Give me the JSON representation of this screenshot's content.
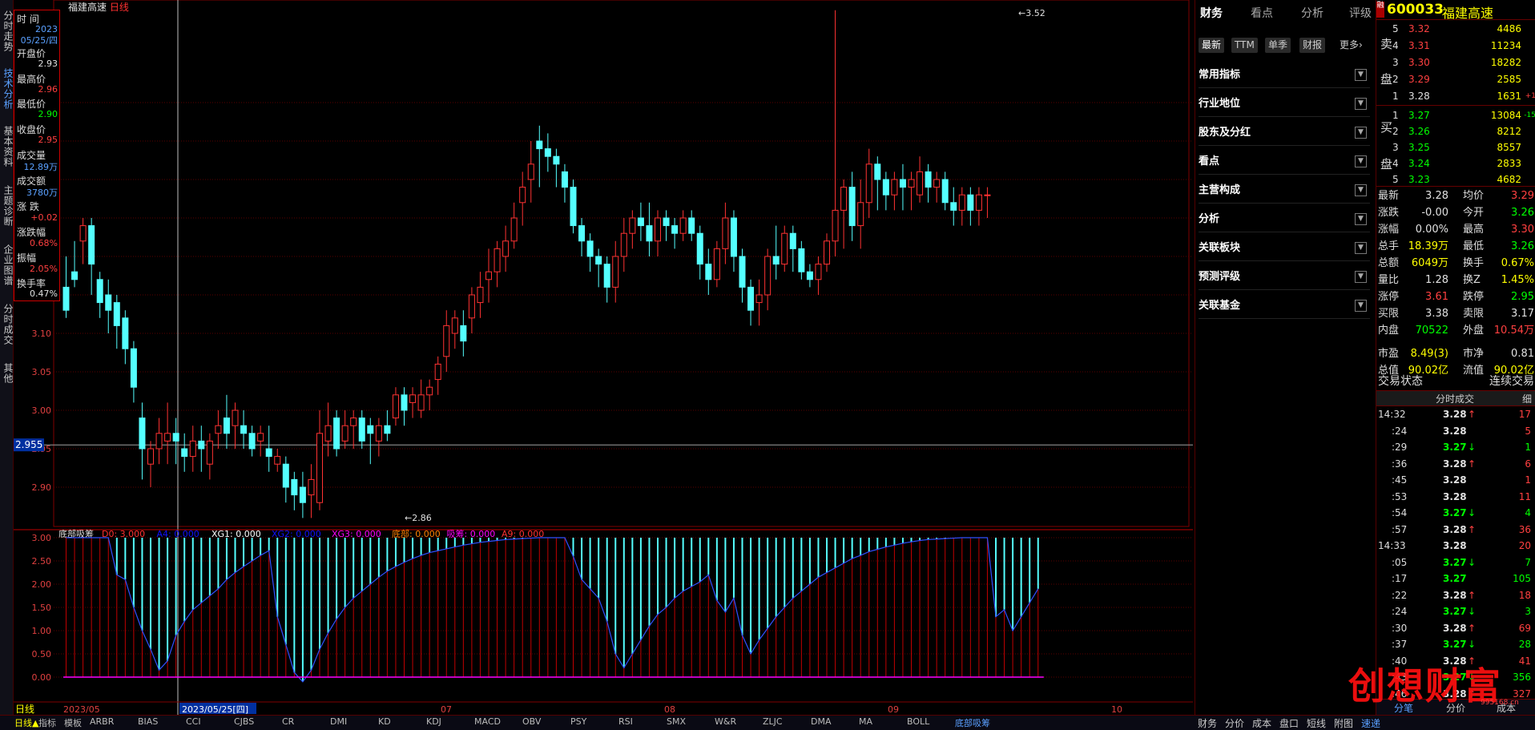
{
  "stock": {
    "code": "600033",
    "name": "福建高速",
    "period": "日线",
    "title": "福建高速"
  },
  "left_tabs": [
    "分时走势",
    "技术分析",
    "基本资料",
    "主题诊断",
    "企业图谱",
    "分时成交",
    "其他"
  ],
  "info_box": [
    {
      "label": "时 间",
      "value": "2023"
    },
    {
      "label": "",
      "value": "05/25/四"
    },
    {
      "label": "开盘价",
      "value": "2.93"
    },
    {
      "label": "最高价",
      "value": "2.96"
    },
    {
      "label": "最低价",
      "value": "2.90"
    },
    {
      "label": "收盘价",
      "value": "2.95"
    },
    {
      "label": "成交量",
      "value": "12.89万"
    },
    {
      "label": "成交额",
      "value": "3780万"
    },
    {
      "label": "涨 跌",
      "value": "+0.02"
    },
    {
      "label": "涨跌幅",
      "value": "0.68%"
    },
    {
      "label": "振幅",
      "value": "2.05%"
    },
    {
      "label": "换手率",
      "value": "0.47%"
    }
  ],
  "chart_data": {
    "type": "candlestick",
    "price_axis": [
      "3.10",
      "3.05",
      "3.00",
      "2.95",
      "2.90"
    ],
    "cursor_price": "2.955",
    "high_label": "3.52",
    "low_label": "2.86",
    "indicator_axis": [
      "3.00",
      "2.50",
      "2.00",
      "1.50",
      "1.00",
      "0.50",
      "0.00"
    ],
    "indicator_title": "底部吸筹",
    "indicator_legend": [
      {
        "text": "D0: 3.000",
        "color": "#ff3030"
      },
      {
        "text": "A4: 0.000",
        "color": "#1010ff"
      },
      {
        "text": "XG1: 0.000",
        "color": "#ffffff"
      },
      {
        "text": "XG2: 0.000",
        "color": "#1010ff"
      },
      {
        "text": "XG3: 0.000",
        "color": "#ff00ff"
      },
      {
        "text": "底部: 0.000",
        "color": "#ff8000"
      },
      {
        "text": "吸筹: 0.000",
        "color": "#ff00ff"
      },
      {
        "text": "A9: 0.000",
        "color": "#ff3030"
      }
    ],
    "date_axis": [
      "2023/05",
      "2023/05/25[四]",
      "07",
      "08",
      "09",
      "10"
    ]
  },
  "fin": {
    "tabs": [
      "财务",
      "看点",
      "分析",
      "评级"
    ],
    "subtabs": [
      "最新",
      "TTM",
      "单季",
      "财报",
      "更多"
    ],
    "sections": [
      "常用指标",
      "行业地位",
      "股东及分红",
      "看点",
      "主营构成",
      "分析",
      "关联板块",
      "预测评级",
      "关联基金"
    ]
  },
  "quote": {
    "sell_label": [
      "卖",
      "盘"
    ],
    "buy_label": [
      "买",
      "盘"
    ],
    "asks": [
      {
        "level": "5",
        "price": "3.32",
        "vol": "4486",
        "chg": ""
      },
      {
        "level": "4",
        "price": "3.31",
        "vol": "11234",
        "chg": ""
      },
      {
        "level": "3",
        "price": "3.30",
        "vol": "18282",
        "chg": ""
      },
      {
        "level": "2",
        "price": "3.29",
        "vol": "2585",
        "chg": ""
      },
      {
        "level": "1",
        "price": "3.28",
        "vol": "1631",
        "chg": "+1"
      }
    ],
    "bids": [
      {
        "level": "1",
        "price": "3.27",
        "vol": "13084",
        "chg": "-15"
      },
      {
        "level": "2",
        "price": "3.26",
        "vol": "8212",
        "chg": ""
      },
      {
        "level": "3",
        "price": "3.25",
        "vol": "8557",
        "chg": ""
      },
      {
        "level": "4",
        "price": "3.24",
        "vol": "2833",
        "chg": ""
      },
      {
        "level": "5",
        "price": "3.23",
        "vol": "4682",
        "chg": ""
      }
    ],
    "stats": [
      {
        "l1": "最新",
        "v1": "3.28",
        "c1": "#e0e0e0",
        "l2": "均价",
        "v2": "3.29",
        "c2": "#ff4040"
      },
      {
        "l1": "涨跌",
        "v1": "-0.00",
        "c1": "#e0e0e0",
        "l2": "今开",
        "v2": "3.26",
        "c2": "#00ff00"
      },
      {
        "l1": "涨幅",
        "v1": "0.00%",
        "c1": "#e0e0e0",
        "l2": "最高",
        "v2": "3.30",
        "c2": "#ff4040"
      },
      {
        "l1": "总手",
        "v1": "18.39万",
        "c1": "#ffff00",
        "l2": "最低",
        "v2": "3.26",
        "c2": "#00ff00"
      },
      {
        "l1": "总额",
        "v1": "6049万",
        "c1": "#ffff00",
        "l2": "换手",
        "v2": "0.67%",
        "c2": "#ffff00"
      },
      {
        "l1": "量比",
        "v1": "1.28",
        "c1": "#e0e0e0",
        "l2": "换Z",
        "v2": "1.45%",
        "c2": "#ffff00"
      },
      {
        "l1": "涨停",
        "v1": "3.61",
        "c1": "#ff4040",
        "l2": "跌停",
        "v2": "2.95",
        "c2": "#00ff00"
      },
      {
        "l1": "买限",
        "v1": "3.38",
        "c1": "#e0e0e0",
        "l2": "卖限",
        "v2": "3.17",
        "c2": "#e0e0e0"
      },
      {
        "l1": "内盘",
        "v1": "70522",
        "c1": "#00ff00",
        "l2": "外盘",
        "v2": "10.54万",
        "c2": "#ff4040"
      },
      {
        "l1": "市盈",
        "v1": "8.49(3)",
        "c1": "#ffff00",
        "l2": "市净",
        "v2": "0.81",
        "c2": "#e0e0e0"
      },
      {
        "l1": "总值",
        "v1": "90.02亿",
        "c1": "#ffff00",
        "l2": "流值",
        "v2": "90.02亿",
        "c2": "#ffff00"
      }
    ],
    "trade_status_label": "交易状态",
    "trade_status_value": "连续交易",
    "ticks_title": "分时成交",
    "ticks_detail": "细",
    "ticks": [
      {
        "t": "14:32",
        "p": "3.28",
        "pc": "#e0e0e0",
        "a": "↑",
        "ac": "#ff4040",
        "v": "17",
        "vc": "#ff4040"
      },
      {
        "t": ":24",
        "p": "3.28",
        "pc": "#e0e0e0",
        "a": "",
        "ac": "",
        "v": "5",
        "vc": "#ff4040"
      },
      {
        "t": ":29",
        "p": "3.27",
        "pc": "#00ff00",
        "a": "↓",
        "ac": "#00ff00",
        "v": "1",
        "vc": "#00ff00"
      },
      {
        "t": ":36",
        "p": "3.28",
        "pc": "#e0e0e0",
        "a": "↑",
        "ac": "#ff4040",
        "v": "6",
        "vc": "#ff4040"
      },
      {
        "t": ":45",
        "p": "3.28",
        "pc": "#e0e0e0",
        "a": "",
        "ac": "",
        "v": "1",
        "vc": "#ff4040"
      },
      {
        "t": ":53",
        "p": "3.28",
        "pc": "#e0e0e0",
        "a": "",
        "ac": "",
        "v": "11",
        "vc": "#ff4040"
      },
      {
        "t": ":54",
        "p": "3.27",
        "pc": "#00ff00",
        "a": "↓",
        "ac": "#00ff00",
        "v": "4",
        "vc": "#00ff00"
      },
      {
        "t": ":57",
        "p": "3.28",
        "pc": "#e0e0e0",
        "a": "↑",
        "ac": "#ff4040",
        "v": "36",
        "vc": "#ff4040"
      },
      {
        "t": "14:33",
        "p": "3.28",
        "pc": "#e0e0e0",
        "a": "",
        "ac": "",
        "v": "20",
        "vc": "#ff4040"
      },
      {
        "t": ":05",
        "p": "3.27",
        "pc": "#00ff00",
        "a": "↓",
        "ac": "#00ff00",
        "v": "7",
        "vc": "#00ff00"
      },
      {
        "t": ":17",
        "p": "3.27",
        "pc": "#00ff00",
        "a": "",
        "ac": "",
        "v": "105",
        "vc": "#00ff00"
      },
      {
        "t": ":22",
        "p": "3.28",
        "pc": "#e0e0e0",
        "a": "↑",
        "ac": "#ff4040",
        "v": "18",
        "vc": "#ff4040"
      },
      {
        "t": ":24",
        "p": "3.27",
        "pc": "#00ff00",
        "a": "↓",
        "ac": "#00ff00",
        "v": "3",
        "vc": "#00ff00"
      },
      {
        "t": ":30",
        "p": "3.28",
        "pc": "#e0e0e0",
        "a": "↑",
        "ac": "#ff4040",
        "v": "69",
        "vc": "#ff4040"
      },
      {
        "t": ":37",
        "p": "3.27",
        "pc": "#00ff00",
        "a": "↓",
        "ac": "#00ff00",
        "v": "28",
        "vc": "#00ff00"
      },
      {
        "t": ":40",
        "p": "3.28",
        "pc": "#e0e0e0",
        "a": "↑",
        "ac": "#ff4040",
        "v": "41",
        "vc": "#ff4040"
      },
      {
        "t": ":43",
        "p": "3.27",
        "pc": "#00ff00",
        "a": "↓",
        "ac": "#00ff00",
        "v": "356",
        "vc": "#00ff00"
      },
      {
        "t": ":46",
        "p": "3.28",
        "pc": "#e0e0e0",
        "a": "↑",
        "ac": "#ff4040",
        "v": "327",
        "vc": "#ff4040"
      }
    ]
  },
  "bottom_tabs": [
    "日线▲",
    "指标",
    "模板",
    "ARBR",
    "BIAS",
    "CCI",
    "CJBS",
    "CR",
    "DMI",
    "KD",
    "KDJ",
    "MACD",
    "OBV",
    "PSY",
    "RSI",
    "SMX",
    "W&R",
    "ZLJC",
    "DMA",
    "MA",
    "BOLL",
    "底部吸筹"
  ],
  "right_bottom_tabs": [
    "财务",
    "分价",
    "成本",
    "盘口",
    "短线",
    "附图",
    "速递"
  ],
  "quote_bottom_tabs": [
    "分笔",
    "分价",
    "成本"
  ],
  "watermark": {
    "text": "创想财富",
    "url": "995168.cn"
  },
  "colors": {
    "up": "#ff3232",
    "down": "#54ffff",
    "bg": "#000000",
    "grid": "#800000"
  }
}
